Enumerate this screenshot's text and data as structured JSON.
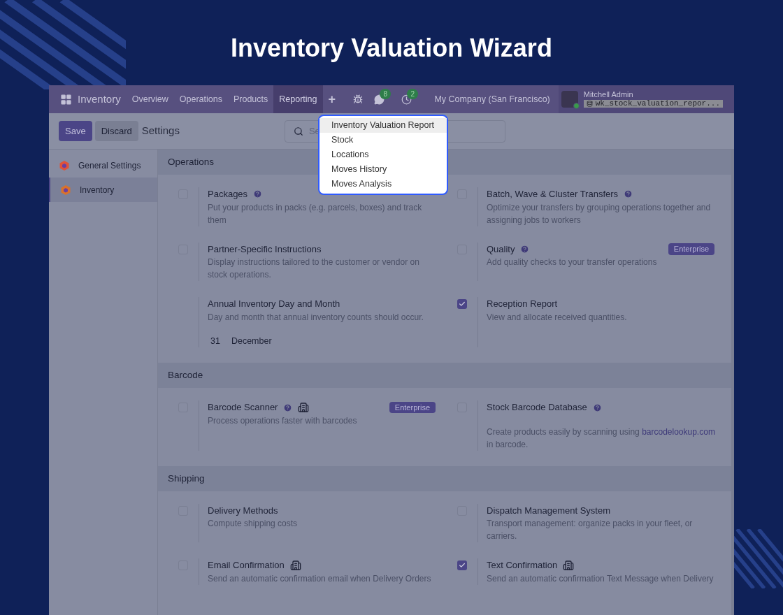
{
  "title": "Inventory Valuation Wizard",
  "navbar": {
    "app_name": "Inventory",
    "menu": [
      {
        "label": "Overview",
        "selected": false
      },
      {
        "label": "Operations",
        "selected": false
      },
      {
        "label": "Products",
        "selected": false
      },
      {
        "label": "Reporting",
        "selected": true
      }
    ],
    "plus": "+",
    "messages_count": "8",
    "activities_count": "2",
    "company": "My Company (San Francisco)",
    "user": "Mitchell Admin",
    "database": "wk_stock_valuation_repor..."
  },
  "control_bar": {
    "save": "Save",
    "discard": "Discard",
    "breadcrumb": "Settings",
    "search_placeholder": "Se"
  },
  "dropdown": [
    {
      "label": "Inventory Valuation Report",
      "selected": true
    },
    {
      "label": "Stock",
      "selected": false
    },
    {
      "label": "Locations",
      "selected": false
    },
    {
      "label": "Moves History",
      "selected": false
    },
    {
      "label": "Moves Analysis",
      "selected": false
    }
  ],
  "sidebar": [
    {
      "label": "General Settings",
      "selected": false,
      "color": "#e0533a"
    },
    {
      "label": "Inventory",
      "selected": true,
      "color": "#d9712b"
    }
  ],
  "sections": [
    {
      "title": "Operations",
      "settings": [
        {
          "kind": "checkbox",
          "title": "Packages",
          "checked": false,
          "help": true,
          "description": "Put your products in packs (e.g. parcels, boxes) and track them"
        },
        {
          "kind": "checkbox",
          "title": "Batch, Wave & Cluster Transfers",
          "checked": false,
          "help": true,
          "description": "Optimize your transfers by grouping operations together and assigning jobs to workers"
        },
        {
          "kind": "checkbox",
          "title": "Partner-Specific Instructions",
          "checked": false,
          "description": "Display instructions tailored to the customer or vendor on stock operations."
        },
        {
          "kind": "checkbox",
          "title": "Quality",
          "checked": false,
          "help": true,
          "badge": "Enterprise",
          "description": "Add quality checks to your transfer operations"
        },
        {
          "kind": "date",
          "title": "Annual Inventory Day and Month",
          "description": "Day and month that annual inventory counts should occur.",
          "day": "31",
          "month": "December"
        },
        {
          "kind": "checkbox",
          "title": "Reception Report",
          "checked": true,
          "description": "View and allocate received quantities."
        }
      ]
    },
    {
      "title": "Barcode",
      "settings": [
        {
          "kind": "checkbox",
          "title": "Barcode Scanner",
          "checked": false,
          "help": true,
          "building_icon": true,
          "badge": "Enterprise",
          "description": "Process operations faster with barcodes"
        },
        {
          "kind": "checkbox",
          "title": "Stock Barcode Database",
          "checked": false,
          "help": true,
          "description": "Create products easily by scanning using",
          "link": "barcodelookup.com",
          "description_after": "in barcode."
        }
      ]
    },
    {
      "title": "Shipping",
      "settings": [
        {
          "kind": "checkbox",
          "title": "Delivery Methods",
          "checked": false,
          "description": "Compute shipping costs"
        },
        {
          "kind": "checkbox",
          "title": "Dispatch Management System",
          "checked": false,
          "description": "Transport management: organize packs in your fleet, or carriers."
        },
        {
          "kind": "checkbox",
          "title": "Email Confirmation",
          "checked": false,
          "building_icon": true,
          "description": "Send an automatic confirmation email when Delivery Orders"
        },
        {
          "kind": "checkbox",
          "title": "Text Confirmation",
          "checked": true,
          "building_icon": true,
          "description": "Send an automatic confirmation Text Message when Delivery"
        }
      ]
    }
  ]
}
